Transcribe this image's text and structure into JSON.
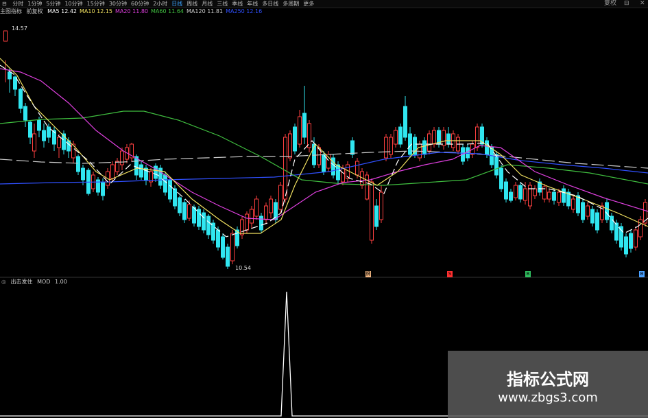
{
  "toolbar": {
    "items": [
      "分时",
      "1分钟",
      "5分钟",
      "10分钟",
      "15分钟",
      "30分钟",
      "60分钟",
      "2小时",
      "日线",
      "周线",
      "月线",
      "三线",
      "季线",
      "年线",
      "多日线",
      "多周期",
      "更多"
    ],
    "active_index": 8,
    "window_controls": [
      "复权",
      "⊟",
      "✕"
    ]
  },
  "legend": {
    "title": "主图指标",
    "sub": "前复权",
    "items": [
      {
        "label": "MA5",
        "value": "12.42",
        "color": "#ffffff"
      },
      {
        "label": "MA10",
        "value": "12.15",
        "color": "#f0e060"
      },
      {
        "label": "MA20",
        "value": "11.80",
        "color": "#e040e0"
      },
      {
        "label": "MA60",
        "value": "11.64",
        "color": "#40c040"
      },
      {
        "label": "MA120",
        "value": "11.81",
        "color": "#cccccc"
      },
      {
        "label": "MA250",
        "value": "12.16",
        "color": "#3050ff"
      }
    ]
  },
  "price_high_label": "14.57",
  "price_low_label": "10.54",
  "indicator": {
    "name": "出击发住",
    "param": "MOD",
    "value": "1.00"
  },
  "signals": [
    {
      "text": "牌",
      "color": "#f2b680"
    },
    {
      "text": "S",
      "color": "#ff3030"
    },
    {
      "text": "B",
      "color": "#30c060"
    },
    {
      "text": "B",
      "color": "#4aa0ff"
    }
  ],
  "colors": {
    "up": "#ff4040",
    "down": "#30e6f0"
  },
  "watermark": {
    "line1": "指标公式网",
    "line2": "www.zbgs3.com"
  }
}
